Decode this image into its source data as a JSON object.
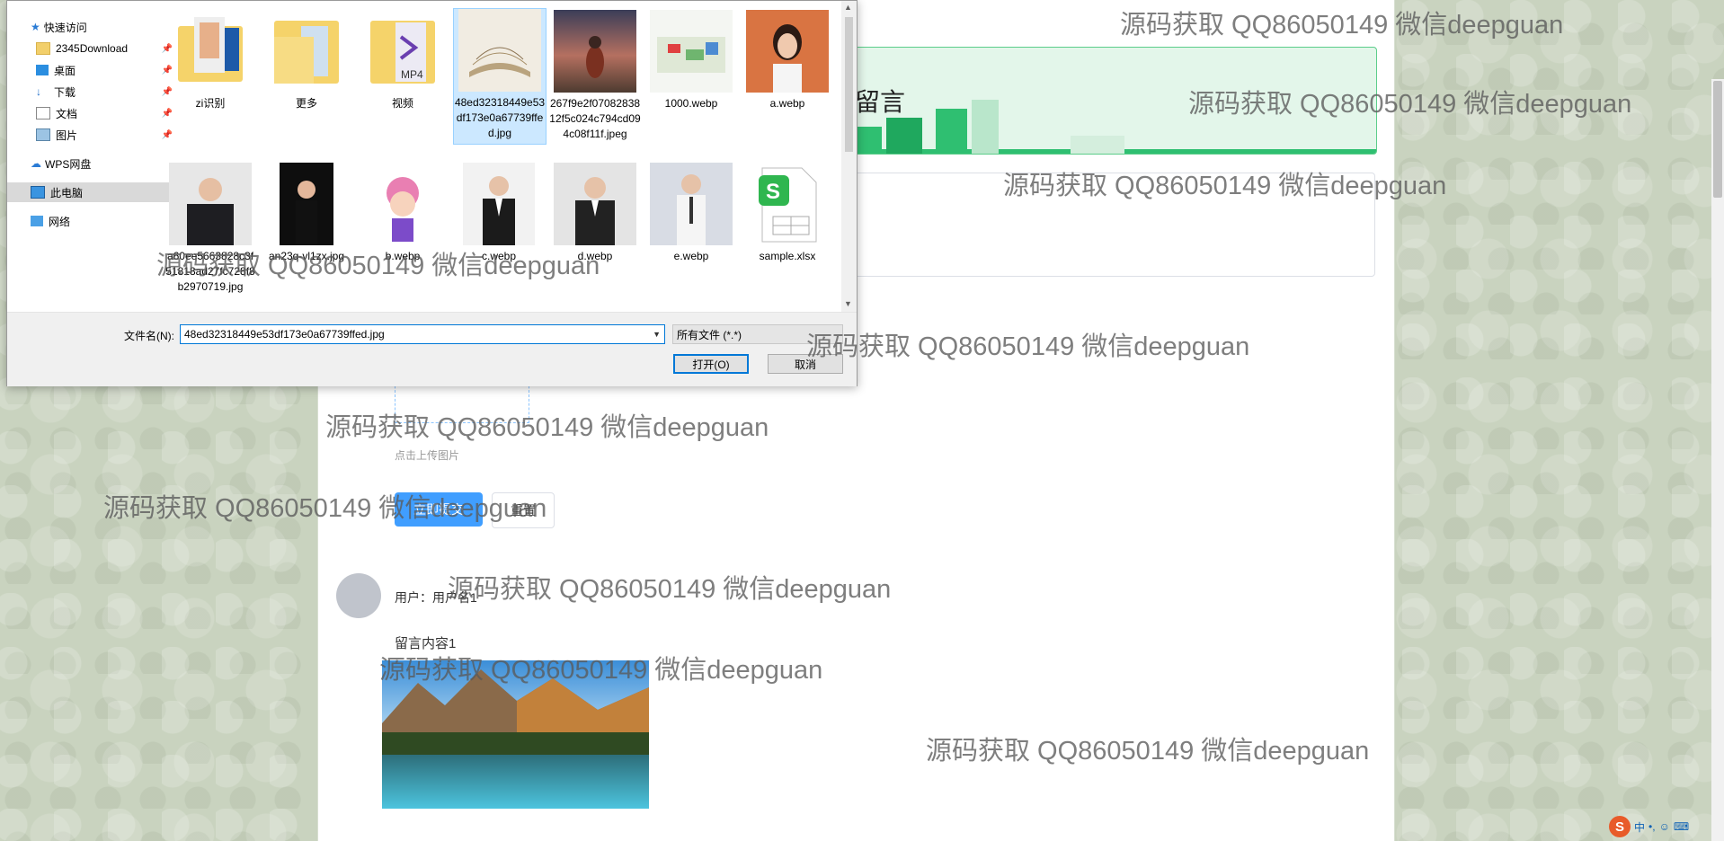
{
  "dialog": {
    "nav": [
      {
        "label": "快速访问",
        "icon": "star-icon",
        "pinned": false
      },
      {
        "label": "2345Download",
        "icon": "folder-icon",
        "pinned": true
      },
      {
        "label": "桌面",
        "icon": "desktop-icon",
        "pinned": true
      },
      {
        "label": "下载",
        "icon": "download-icon",
        "pinned": true
      },
      {
        "label": "文档",
        "icon": "document-icon",
        "pinned": true
      },
      {
        "label": "图片",
        "icon": "picture-icon",
        "pinned": true
      },
      {
        "label": "WPS网盘",
        "icon": "cloud-icon",
        "pinned": false
      },
      {
        "label": "此电脑",
        "icon": "computer-icon",
        "pinned": false,
        "selected": true
      },
      {
        "label": "网络",
        "icon": "network-icon",
        "pinned": false
      }
    ],
    "files": [
      {
        "name": "zi识别",
        "kind": "folder-photo"
      },
      {
        "name": "更多",
        "kind": "folder"
      },
      {
        "name": "视频",
        "kind": "folder-video"
      },
      {
        "name": "48ed32318449e53df173e0a67739ffed.jpg",
        "kind": "book",
        "selected": true
      },
      {
        "name": "267f9e2f0708283812f5c024c794cd094c08f11f.jpeg",
        "kind": "sunset"
      },
      {
        "name": "1000.webp",
        "kind": "map"
      },
      {
        "name": "a.webp",
        "kind": "woman-orange"
      },
      {
        "name": "a60ee5663828c3f51818ad27fc728f8b2970719.jpg",
        "kind": "man-suit"
      },
      {
        "name": "an23q-vl1zx.jpg",
        "kind": "woman-dark"
      },
      {
        "name": "b.webp",
        "kind": "cartoon"
      },
      {
        "name": "c.webp",
        "kind": "woman-suit"
      },
      {
        "name": "d.webp",
        "kind": "woman-suit2"
      },
      {
        "name": "e.webp",
        "kind": "man-shirt"
      },
      {
        "name": "sample.xlsx",
        "kind": "xlsx"
      }
    ],
    "filename_label": "文件名(N):",
    "filename_value": "48ed32318449e53df173e0a67739ffed.jpg",
    "filetype": "所有文件 (*.*)",
    "open_label": "打开(O)",
    "cancel_label": "取消"
  },
  "page": {
    "banner_title": "留言",
    "upload_tip": "点击上传图片",
    "submit_label": "立即提交",
    "reset_label": "重置",
    "message": {
      "user_label": "用户：",
      "user_name": "用户名1",
      "content": "留言内容1"
    }
  },
  "watermark_text": "源码获取 QQ86050149 微信deepguan",
  "taskbar": {
    "ime_logo": "S",
    "ime_lang": "中",
    "ime_punct": "•,",
    "emoji_icon": "smiley-icon",
    "keyboard_icon": "keyboard-icon"
  },
  "colors": {
    "accent": "#409eff",
    "banner_border": "#5ccd8a",
    "banner_bg": "#e3f6ea",
    "selection": "#cce8ff"
  }
}
